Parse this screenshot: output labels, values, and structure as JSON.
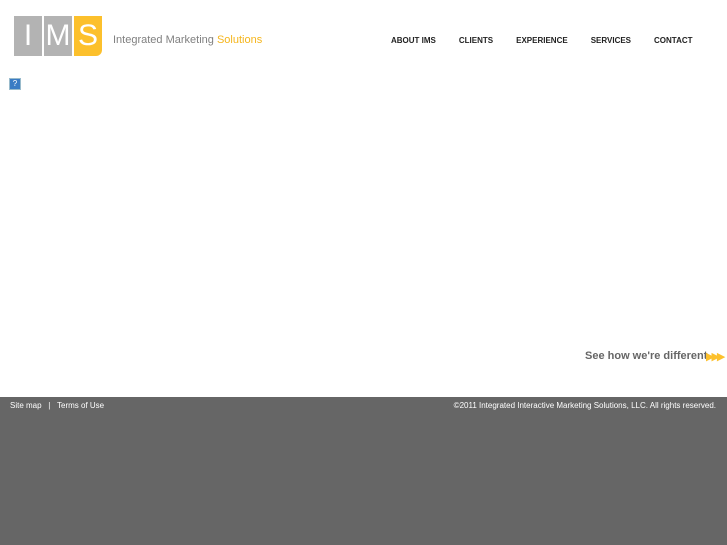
{
  "logo": {
    "letters": [
      "I",
      "M",
      "S"
    ],
    "tagline": "Integrated Marketing",
    "tagline_accent": "Solutions"
  },
  "nav": [
    "ABOUT IMS",
    "CLIENTS",
    "EXPERIENCE",
    "SERVICES",
    "CONTACT"
  ],
  "help_icon": "?",
  "cta": {
    "label": "See how we're different",
    "arrows": "▶▶▶"
  },
  "footer": {
    "sitemap": "Site map",
    "sep": "|",
    "terms": "Terms of Use",
    "copyright": "©2011 Integrated Interactive Marketing Solutions, LLC. All rights reserved."
  }
}
